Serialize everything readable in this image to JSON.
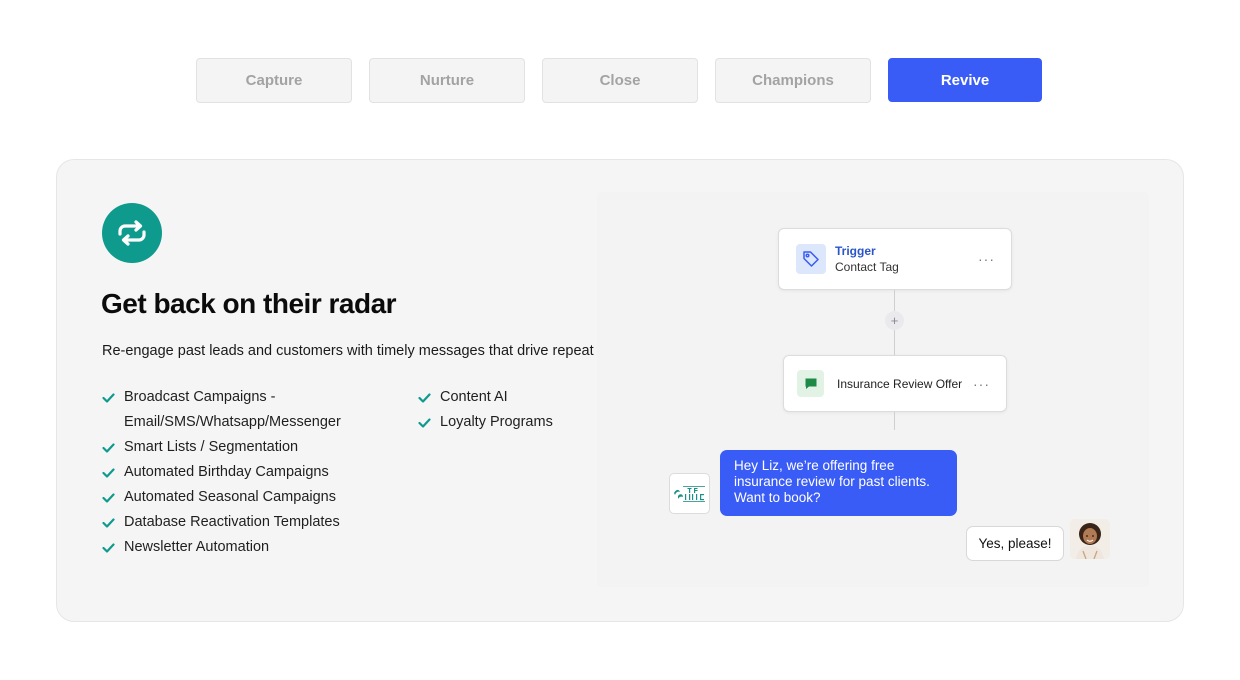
{
  "tabs": [
    {
      "label": "Capture",
      "active": false
    },
    {
      "label": "Nurture",
      "active": false
    },
    {
      "label": "Close",
      "active": false
    },
    {
      "label": "Champions",
      "active": false
    },
    {
      "label": "Revive",
      "active": true
    }
  ],
  "card": {
    "icon": "refresh-cycle-icon",
    "headline": "Get back on their radar",
    "subtext": "Re-engage past leads and customers with timely messages that drive repeat sales.",
    "features_left": [
      "Broadcast Campaigns - Email/SMS/Whatsapp/Messenger",
      "Smart Lists / Segmentation",
      "Automated Birthday Campaigns",
      "Automated Seasonal Campaigns",
      "Database Reactivation Templates",
      "Newsletter Automation"
    ],
    "features_right": [
      "Content AI",
      "Loyalty Programs"
    ]
  },
  "workflow": {
    "trigger": {
      "title": "Trigger",
      "subtitle": "Contact Tag",
      "icon": "tag-icon",
      "more": "···"
    },
    "add": "+",
    "action": {
      "label": "Insurance Review Offer",
      "icon": "chat-bubble-icon",
      "more": "···"
    }
  },
  "chat": {
    "logo_icon": "company-logo-icon",
    "outgoing": "Hey Liz, we’re offering free insurance review for past clients. Want to book?",
    "incoming": "Yes, please!",
    "avatar_icon": "customer-avatar-icon"
  },
  "colors": {
    "accent": "#3a5cf6",
    "teal": "#0f9a8e",
    "check": "#0f9a8e"
  }
}
